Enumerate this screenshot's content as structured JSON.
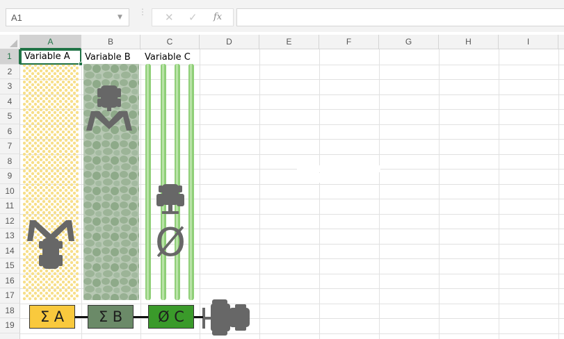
{
  "formula_bar": {
    "cell_ref": "A1",
    "cancel_icon": "✕",
    "enter_icon": "✓",
    "fx_label": "fx",
    "formula_value": ""
  },
  "sheet": {
    "columns": [
      "A",
      "B",
      "C",
      "D",
      "E",
      "F",
      "G",
      "H",
      "I"
    ],
    "rows": [
      "1",
      "2",
      "3",
      "4",
      "5",
      "6",
      "7",
      "8",
      "9",
      "10",
      "11",
      "12",
      "13",
      "14",
      "15",
      "16",
      "17",
      "18",
      "19"
    ],
    "selected_cell": "A1",
    "header_cells": {
      "A1": "Variable A",
      "B1": "Variable B",
      "C1": "Variable C"
    }
  },
  "illustration": {
    "strip_a_icon": "tractor-icon",
    "strip_b_icon": "tractor-icon",
    "strip_c_icon": "tractor-icon",
    "strip_c_symbol": "Ø",
    "legend": [
      {
        "label": "Σ A",
        "color": "#f9c93d"
      },
      {
        "label": "Σ B",
        "color": "#6b8a68"
      },
      {
        "label": "Ø C",
        "color": "#3a9a2a"
      }
    ],
    "colors": {
      "strip_a_dots": "#f7df8a",
      "strip_b_blobs": "#98b193",
      "strip_c_rows": "#8fcf78",
      "machine": "#676767"
    }
  }
}
